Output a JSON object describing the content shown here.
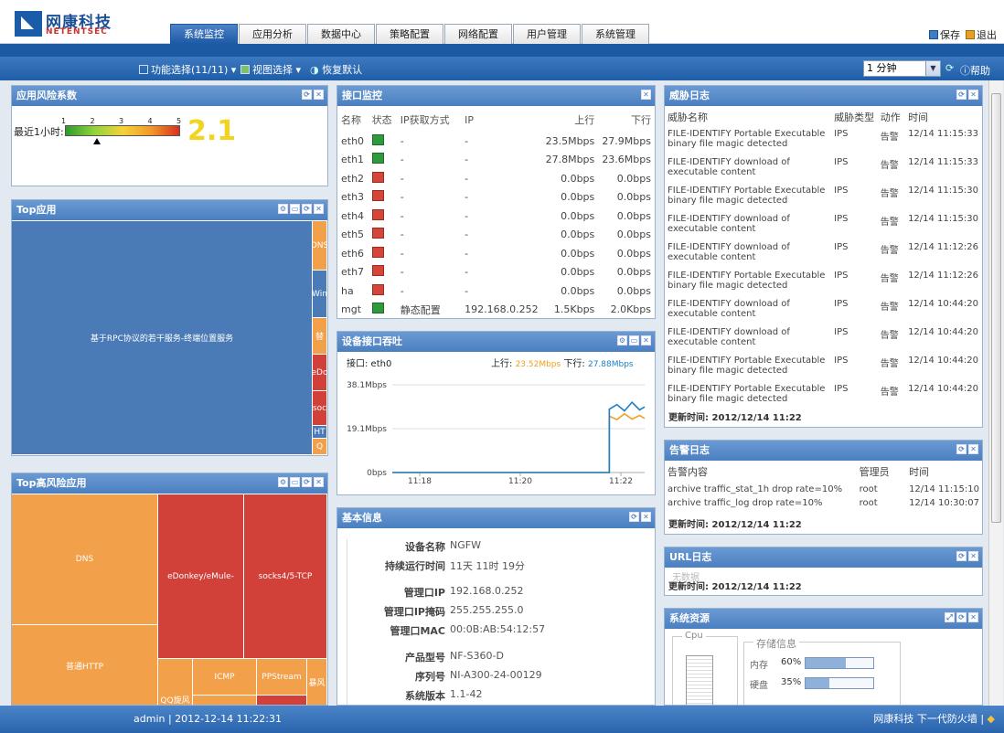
{
  "header": {
    "logo_cn": "网康科技",
    "logo_en": "NETENTSEC",
    "tabs": [
      "系统监控",
      "应用分析",
      "数据中心",
      "策略配置",
      "网络配置",
      "用户管理",
      "系统管理"
    ],
    "active_tab": 0,
    "save_label": "保存",
    "logout_label": "退出"
  },
  "toolbar": {
    "function_select": "功能选择(11/11)",
    "view_select": "视图选择",
    "restore_default": "恢复默认",
    "interval": "1 分钟",
    "help": "帮助"
  },
  "risk_panel": {
    "title": "应用风险系数",
    "label": "最近1小时:",
    "ticks": [
      "1",
      "2",
      "3",
      "4",
      "5"
    ],
    "value": "2.1",
    "value_num": 2.1
  },
  "top_apps": {
    "title": "Top应用",
    "cells": [
      "基于RPC协议的若干服务-终端位置服务",
      "DNS",
      "Win",
      "替",
      "eDo",
      "soc",
      "HT",
      "Q"
    ]
  },
  "top_risk_apps": {
    "title": "Top高风险应用",
    "cells": [
      "DNS",
      "eDonkey/eMule-",
      "socks4/5-TCP",
      "普通HTTP",
      "QQ旋风",
      "ICMP",
      "PPStream",
      "暴风"
    ]
  },
  "interface_monitor": {
    "title": "接口监控",
    "headers": [
      "名称",
      "状态",
      "IP获取方式",
      "IP",
      "上行",
      "下行"
    ],
    "rows": [
      {
        "name": "eth0",
        "status": "up",
        "method": "-",
        "ip": "-",
        "up": "23.5Mbps",
        "down": "27.9Mbps"
      },
      {
        "name": "eth1",
        "status": "up",
        "method": "-",
        "ip": "-",
        "up": "27.8Mbps",
        "down": "23.6Mbps"
      },
      {
        "name": "eth2",
        "status": "down",
        "method": "-",
        "ip": "-",
        "up": "0.0bps",
        "down": "0.0bps"
      },
      {
        "name": "eth3",
        "status": "down",
        "method": "-",
        "ip": "-",
        "up": "0.0bps",
        "down": "0.0bps"
      },
      {
        "name": "eth4",
        "status": "down",
        "method": "-",
        "ip": "-",
        "up": "0.0bps",
        "down": "0.0bps"
      },
      {
        "name": "eth5",
        "status": "down",
        "method": "-",
        "ip": "-",
        "up": "0.0bps",
        "down": "0.0bps"
      },
      {
        "name": "eth6",
        "status": "down",
        "method": "-",
        "ip": "-",
        "up": "0.0bps",
        "down": "0.0bps"
      },
      {
        "name": "eth7",
        "status": "down",
        "method": "-",
        "ip": "-",
        "up": "0.0bps",
        "down": "0.0bps"
      },
      {
        "name": "ha",
        "status": "down",
        "method": "-",
        "ip": "-",
        "up": "0.0bps",
        "down": "0.0bps"
      },
      {
        "name": "mgt",
        "status": "up",
        "method": "静态配置",
        "ip": "192.168.0.252",
        "up": "1.5Kbps",
        "down": "2.0Kbps"
      }
    ]
  },
  "throughput": {
    "title": "设备接口吞吐",
    "iface_label": "接口: eth0",
    "up_label": "上行:",
    "up_value": "23.52Mbps",
    "down_label": "下行:",
    "down_value": "27.88Mbps",
    "up_color": "#f0a020",
    "down_color": "#1a7fc8"
  },
  "chart_data": {
    "type": "line",
    "x": [
      "11:18",
      "11:20",
      "11:22"
    ],
    "y_ticks": [
      "38.1Mbps",
      "19.1Mbps",
      "0bps"
    ],
    "ylim": [
      0,
      38.1
    ],
    "series": [
      {
        "name": "上行",
        "color": "#f0a020",
        "points": [
          [
            0,
            0
          ],
          [
            0.86,
            0
          ],
          [
            0.86,
            24.5
          ],
          [
            0.89,
            23.0
          ],
          [
            0.92,
            25.5
          ],
          [
            0.95,
            23.2
          ],
          [
            0.98,
            24.8
          ],
          [
            1.0,
            23.5
          ]
        ]
      },
      {
        "name": "下行",
        "color": "#1a7fc8",
        "points": [
          [
            0,
            0
          ],
          [
            0.86,
            0
          ],
          [
            0.86,
            27.5
          ],
          [
            0.89,
            29.5
          ],
          [
            0.92,
            26.8
          ],
          [
            0.95,
            30.5
          ],
          [
            0.98,
            27.2
          ],
          [
            1.0,
            28.5
          ]
        ]
      }
    ]
  },
  "basic_info": {
    "title": "基本信息",
    "rows": [
      {
        "k": "设备名称",
        "v": "NGFW"
      },
      {
        "k": "持续运行时间",
        "v": "11天 11时 19分"
      },
      {
        "k": "管理口IP",
        "v": "192.168.0.252"
      },
      {
        "k": "管理口IP掩码",
        "v": "255.255.255.0"
      },
      {
        "k": "管理口MAC",
        "v": "00:0B:AB:54:12:57"
      },
      {
        "k": "产品型号",
        "v": "NF-S360-D"
      },
      {
        "k": "序列号",
        "v": "NI-A300-24-00129"
      },
      {
        "k": "系统版本",
        "v": "1.1-42"
      }
    ]
  },
  "threat_log": {
    "title": "威胁日志",
    "headers": [
      "威胁名称",
      "威胁类型",
      "动作",
      "时间"
    ],
    "rows": [
      {
        "name": "FILE-IDENTIFY Portable Executable binary file magic detected",
        "type": "IPS",
        "action": "告警",
        "time": "12/14 11:15:33"
      },
      {
        "name": "FILE-IDENTIFY download of executable content",
        "type": "IPS",
        "action": "告警",
        "time": "12/14 11:15:33"
      },
      {
        "name": "FILE-IDENTIFY Portable Executable binary file magic detected",
        "type": "IPS",
        "action": "告警",
        "time": "12/14 11:15:30"
      },
      {
        "name": "FILE-IDENTIFY download of executable content",
        "type": "IPS",
        "action": "告警",
        "time": "12/14 11:15:30"
      },
      {
        "name": "FILE-IDENTIFY download of executable content",
        "type": "IPS",
        "action": "告警",
        "time": "12/14 11:12:26"
      },
      {
        "name": "FILE-IDENTIFY Portable Executable binary file magic detected",
        "type": "IPS",
        "action": "告警",
        "time": "12/14 11:12:26"
      },
      {
        "name": "FILE-IDENTIFY download of executable content",
        "type": "IPS",
        "action": "告警",
        "time": "12/14 10:44:20"
      },
      {
        "name": "FILE-IDENTIFY download of executable content",
        "type": "IPS",
        "action": "告警",
        "time": "12/14 10:44:20"
      },
      {
        "name": "FILE-IDENTIFY Portable Executable binary file magic detected",
        "type": "IPS",
        "action": "告警",
        "time": "12/14 10:44:20"
      },
      {
        "name": "FILE-IDENTIFY Portable Executable binary file magic detected",
        "type": "IPS",
        "action": "告警",
        "time": "12/14 10:44:20"
      }
    ],
    "updated": "更新时间: 2012/12/14 11:22"
  },
  "alert_log": {
    "title": "告警日志",
    "headers": [
      "告警内容",
      "管理员",
      "时间"
    ],
    "rows": [
      {
        "content": "archive traffic_stat_1h drop rate=10%",
        "admin": "root",
        "time": "12/14 11:15:10"
      },
      {
        "content": "archive traffic_log drop rate=10%",
        "admin": "root",
        "time": "12/14 10:30:07"
      }
    ],
    "updated": "更新时间: 2012/12/14 11:22"
  },
  "url_log": {
    "title": "URL日志",
    "empty": "无数据",
    "updated": "更新时间: 2012/12/14 11:22"
  },
  "system_resources": {
    "title": "系统资源",
    "cpu_label": "Cpu",
    "storage_title": "存储信息",
    "memory_label": "内存",
    "memory_pct": "60%",
    "memory_value": 0.6,
    "disk_label": "硬盘",
    "disk_pct": "35%",
    "disk_value": 0.35
  },
  "footer": {
    "user": "admin | 2012-12-14 11:22:31",
    "brand": "网康科技 下一代防火墙 |"
  }
}
